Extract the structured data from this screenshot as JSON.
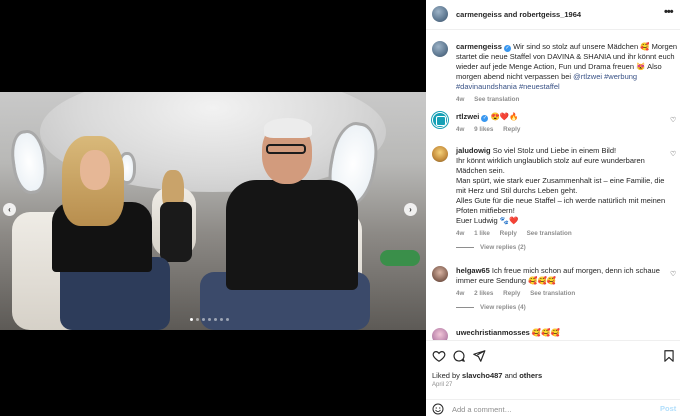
{
  "header": {
    "title": "carmengeiss and robertgeiss_1964",
    "more_icon": "ellipsis-icon"
  },
  "caption": {
    "username": "carmengeiss",
    "text": "Wir sind so stolz auf unsere Mädchen 🥰 Morgen startet die neue Staffel von DAVINA & SHANIA und ihr könnt euch wieder auf jede Menge Action, Fun und Drama freuen 😻 Also morgen abend nicht verpassen bei",
    "mention": "@rtlzwei",
    "tags": "#werbung #davinaundshania #neuestaffel",
    "time": "4w",
    "see_translation": "See translation"
  },
  "comments": [
    {
      "username": "rtlzwei",
      "text": "😍❤️🔥",
      "time": "4w",
      "likes": "9 likes",
      "reply": "Reply"
    },
    {
      "username": "jaludowig",
      "lines": [
        "So viel Stolz und Liebe in einem Bild!",
        "Ihr könnt wirklich unglaublich stolz auf eure wunderbaren Mädchen sein.",
        "Man spürt, wie stark euer Zusammenhalt ist – eine Familie, die mit Herz und Stil durchs Leben geht.",
        "Alles Gute für die neue Staffel – ich werde natürlich mit meinen Pfoten mitfiebern!",
        "Euer Ludwig 🐾❤️"
      ],
      "time": "4w",
      "likes": "1 like",
      "reply": "Reply",
      "see_translation": "See translation",
      "view_replies": "View replies (2)"
    },
    {
      "username": "helgaw65",
      "text": "Ich freue mich schon auf morgen, denn ich schaue immer eure Sendung 🥰🥰🥰",
      "time": "4w",
      "likes": "2 likes",
      "reply": "Reply",
      "see_translation": "See translation",
      "view_replies": "View replies (4)"
    },
    {
      "username": "uwechristianmosses",
      "text": "🥰🥰🥰"
    }
  ],
  "footer": {
    "likes_prefix": "Liked by",
    "liked_by_user": "slavcho487",
    "likes_and": "and",
    "likes_others": "others",
    "date": "April 27",
    "add_comment_placeholder": "Add a comment…",
    "post_label": "Post",
    "icons": [
      "heart-icon",
      "comment-icon",
      "share-icon",
      "bookmark-icon",
      "emoji-icon"
    ]
  },
  "carousel": {
    "slides": 7,
    "active_index": 0
  },
  "colors": {
    "link": "#385185",
    "verified": "#3897f0",
    "muted": "#8e8e8e",
    "post_disabled": "#b2dffc"
  }
}
